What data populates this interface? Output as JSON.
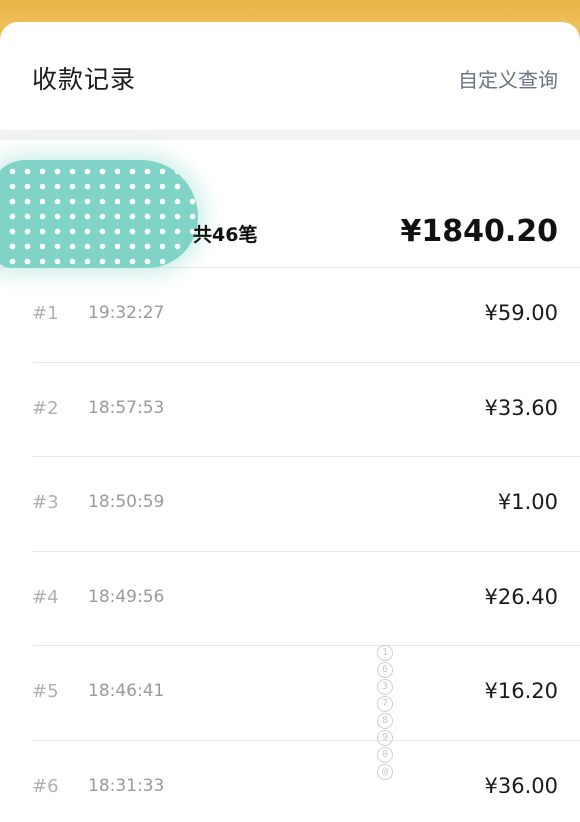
{
  "header": {
    "title": "收款记录",
    "custom_query_label": "自定义查询"
  },
  "summary": {
    "count_text": "共46笔",
    "total_amount": "¥1840.20"
  },
  "records": [
    {
      "index": "#1",
      "time": "19:32:27",
      "amount": "¥59.00"
    },
    {
      "index": "#2",
      "time": "18:57:53",
      "amount": "¥33.60"
    },
    {
      "index": "#3",
      "time": "18:50:59",
      "amount": "¥1.00"
    },
    {
      "index": "#4",
      "time": "18:49:56",
      "amount": "¥26.40"
    },
    {
      "index": "#5",
      "time": "18:46:41",
      "amount": "¥16.20"
    },
    {
      "index": "#6",
      "time": "18:31:33",
      "amount": "¥36.00"
    }
  ],
  "watermark": [
    "1",
    "6",
    "3",
    "7",
    "8",
    "9",
    "0",
    "@"
  ],
  "colors": {
    "background_accent": "#e9b94a",
    "redaction": "#7fd3c7",
    "link_text": "#6c7380"
  }
}
